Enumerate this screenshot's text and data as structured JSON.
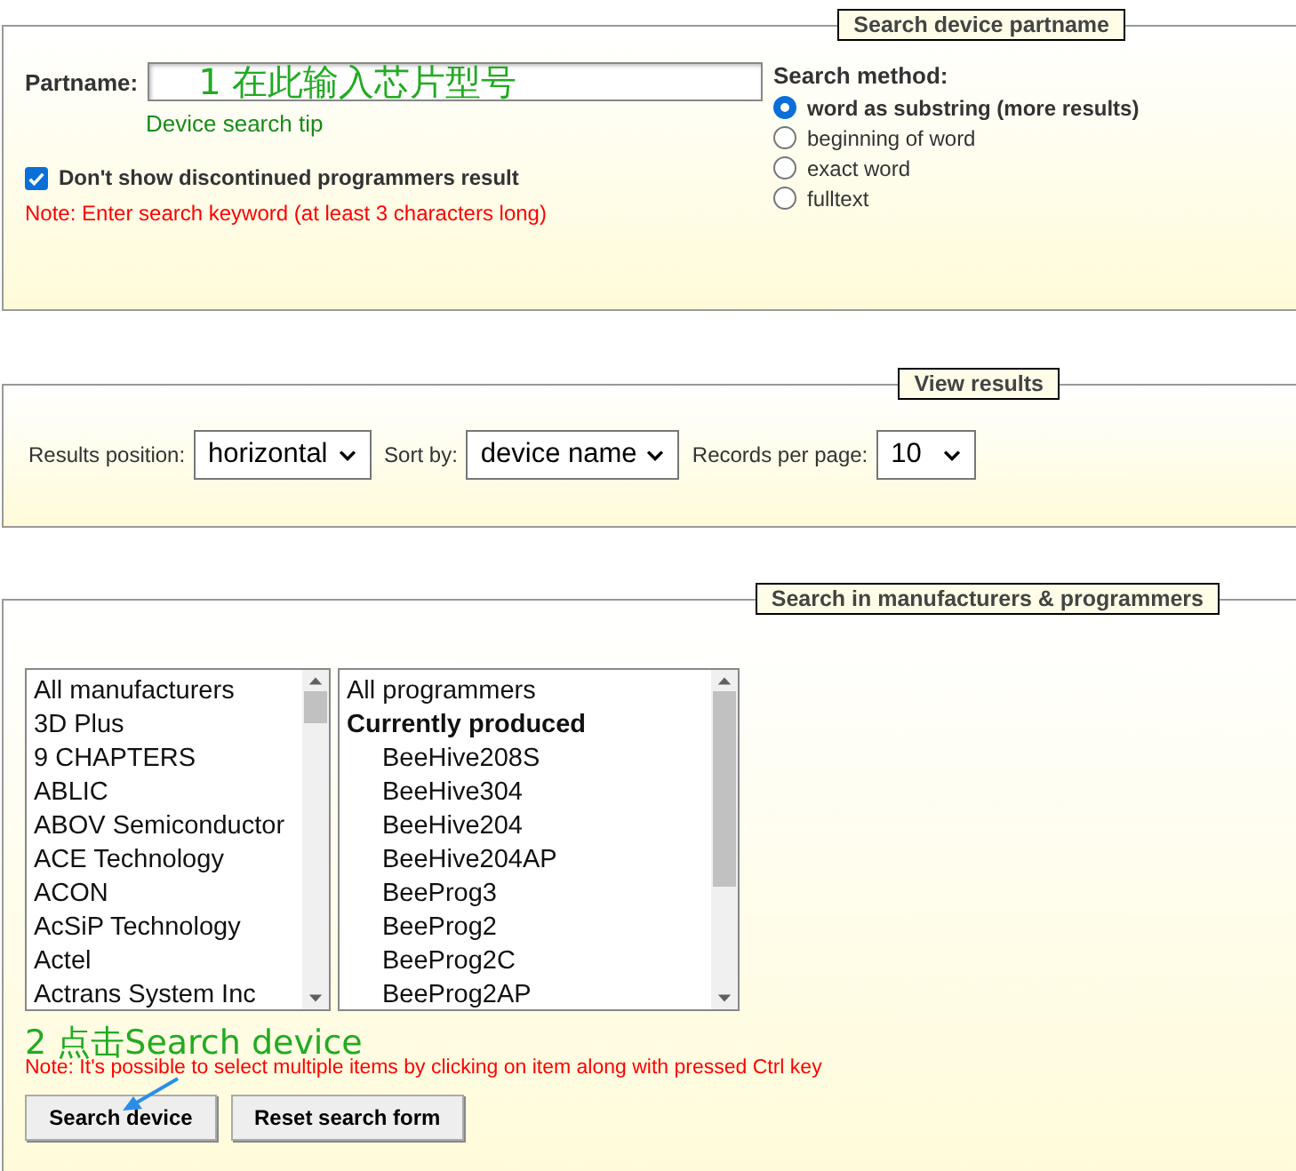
{
  "partname_section": {
    "legend": "Search device partname",
    "label": "Partname:",
    "value": "1 在此输入芯片型号",
    "tip": "Device search tip",
    "discontinued": {
      "label": "Don't show discontinued programmers result",
      "checked": true
    },
    "note": "Note: Enter search keyword (at least 3 characters long)",
    "method": {
      "label": "Search method:",
      "options": [
        {
          "label": "word as substring (more results)",
          "selected": true
        },
        {
          "label": "beginning of word",
          "selected": false
        },
        {
          "label": "exact word",
          "selected": false
        },
        {
          "label": "fulltext",
          "selected": false
        }
      ]
    }
  },
  "view_section": {
    "legend": "View results",
    "controls": [
      {
        "label": "Results position:",
        "value": "horizontal"
      },
      {
        "label": "Sort by:",
        "value": "device name"
      },
      {
        "label": "Records per page:",
        "value": "10"
      }
    ]
  },
  "manufacturers_section": {
    "legend": "Search in manufacturers & programmers",
    "manufacturers": [
      "All manufacturers",
      "3D Plus",
      "9 CHAPTERS",
      "ABLIC",
      "ABOV Semiconductor",
      "ACE Technology",
      "ACON",
      "AcSiP Technology",
      "Actel",
      "Actrans System Inc"
    ],
    "programmers": [
      {
        "text": "All programmers"
      },
      {
        "text": "Currently produced",
        "children": [
          {
            "text": "BeeHive208S"
          },
          {
            "text": "BeeHive304"
          },
          {
            "text": "BeeHive204"
          },
          {
            "text": "BeeHive204AP"
          },
          {
            "text": "BeeProg3"
          },
          {
            "text": "BeeProg2"
          },
          {
            "text": "BeeProg2C"
          },
          {
            "text": "BeeProg2AP"
          }
        ]
      }
    ],
    "annotation": "2 点击Search device",
    "note": "Note: It's possible to select multiple items by clicking on item along with pressed Ctrl key",
    "buttons": [
      "Search device",
      "Reset search form"
    ]
  }
}
